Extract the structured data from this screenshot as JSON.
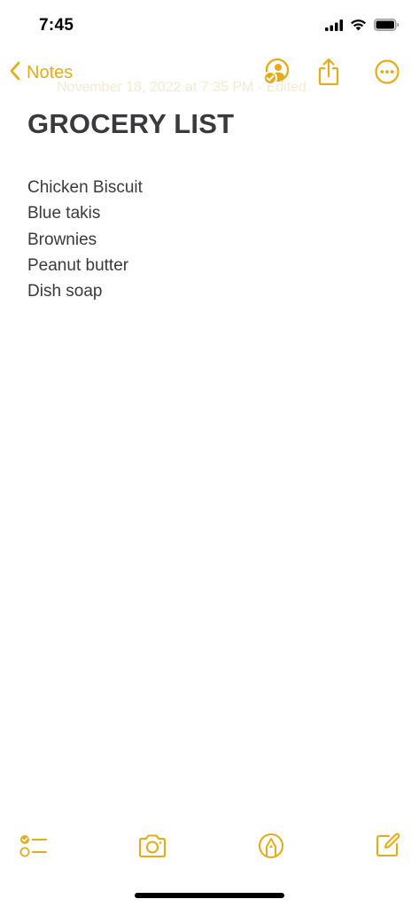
{
  "status_bar": {
    "time": "7:45"
  },
  "nav": {
    "back_label": "Notes",
    "ghost_date": "November 18, 2022 at 7:35 PM · Edited",
    "icons": [
      "chevron-left-icon",
      "collaborate-person-icon",
      "share-icon",
      "more-ellipsis-icon"
    ]
  },
  "note": {
    "title": "GROCERY LIST",
    "lines": [
      "Chicken Biscuit",
      "Blue takis",
      "Brownies",
      "Peanut butter",
      "Dish soap"
    ]
  },
  "toolbar": {
    "icons": [
      "checklist-icon",
      "camera-icon",
      "markup-pen-icon",
      "compose-icon"
    ]
  },
  "colors": {
    "accent": "#e3ac1a",
    "text": "#3a3a3c",
    "background": "#ffffff"
  }
}
